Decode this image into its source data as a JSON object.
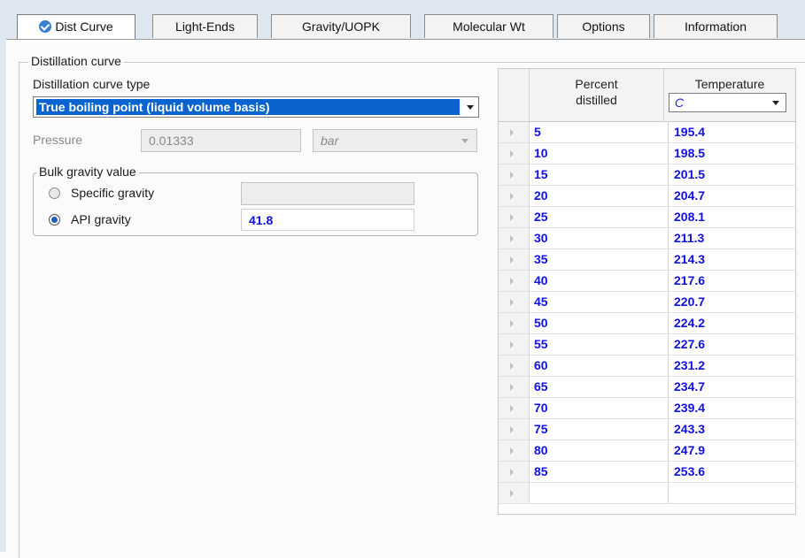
{
  "tabs": [
    {
      "label": "Dist Curve",
      "active": true,
      "icon": "check-circle-icon"
    },
    {
      "label": "Light-Ends",
      "active": false
    },
    {
      "label": "Gravity/UOPK",
      "active": false
    },
    {
      "label": "Molecular Wt",
      "active": false
    },
    {
      "label": "Options",
      "active": false
    },
    {
      "label": "Information",
      "active": false
    }
  ],
  "distillation": {
    "group_title": "Distillation curve",
    "curve_type_label": "Distillation curve type",
    "curve_type_value": "True boiling point (liquid volume basis)",
    "pressure_label": "Pressure",
    "pressure_value": "0.01333",
    "pressure_unit": "bar"
  },
  "bulk_gravity": {
    "group_title": "Bulk gravity value",
    "specific_gravity_label": "Specific gravity",
    "specific_gravity_value": "",
    "api_gravity_label": "API gravity",
    "api_gravity_value": "41.8",
    "selected": "api"
  },
  "grid": {
    "col1_header_line1": "Percent",
    "col1_header_line2": "distilled",
    "col2_header": "Temperature",
    "temperature_unit": "C",
    "rows": [
      {
        "percent": "5",
        "temp": "195.4"
      },
      {
        "percent": "10",
        "temp": "198.5"
      },
      {
        "percent": "15",
        "temp": "201.5"
      },
      {
        "percent": "20",
        "temp": "204.7"
      },
      {
        "percent": "25",
        "temp": "208.1"
      },
      {
        "percent": "30",
        "temp": "211.3"
      },
      {
        "percent": "35",
        "temp": "214.3"
      },
      {
        "percent": "40",
        "temp": "217.6"
      },
      {
        "percent": "45",
        "temp": "220.7"
      },
      {
        "percent": "50",
        "temp": "224.2"
      },
      {
        "percent": "55",
        "temp": "227.6"
      },
      {
        "percent": "60",
        "temp": "231.2"
      },
      {
        "percent": "65",
        "temp": "234.7"
      },
      {
        "percent": "70",
        "temp": "239.4"
      },
      {
        "percent": "75",
        "temp": "243.3"
      },
      {
        "percent": "80",
        "temp": "247.9"
      },
      {
        "percent": "85",
        "temp": "253.6"
      },
      {
        "percent": "",
        "temp": ""
      }
    ]
  },
  "colors": {
    "selection": "#0a64d0",
    "value_text": "#1010e0",
    "tab_background": "#dfe7f1"
  }
}
